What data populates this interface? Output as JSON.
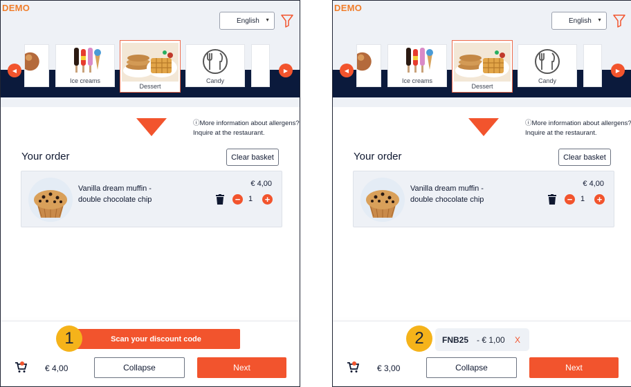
{
  "brand": {
    "demo_label": "DEMO"
  },
  "header": {
    "language": "English"
  },
  "categories": [
    {
      "label": ""
    },
    {
      "label": "Ice creams"
    },
    {
      "label": "Dessert"
    },
    {
      "label": "Candy"
    },
    {
      "label": ""
    }
  ],
  "info": {
    "allergen_text": "More information about allergens? Inquire at the restaurant.",
    "info_glyph": "ⓘ"
  },
  "order": {
    "title": "Your order",
    "clear_label": "Clear basket",
    "item": {
      "name": "Vanilla dream muffin - double chocolate chip",
      "price": "€ 4,00",
      "quantity": "1"
    }
  },
  "footer_left": {
    "step_number": "1",
    "scan_label": "Scan your discount code",
    "total": "€ 4,00",
    "collapse_label": "Collapse",
    "next_label": "Next"
  },
  "footer_right": {
    "step_number": "2",
    "discount_code": "FNB25",
    "discount_amount": "- € 1,00",
    "remove_label": "X",
    "total": "€ 3,00",
    "collapse_label": "Collapse",
    "next_label": "Next"
  },
  "colors": {
    "accent": "#f2542d",
    "navy": "#0b1a3c",
    "badge": "#f5b31a",
    "brand_orange": "#f07d2a"
  }
}
